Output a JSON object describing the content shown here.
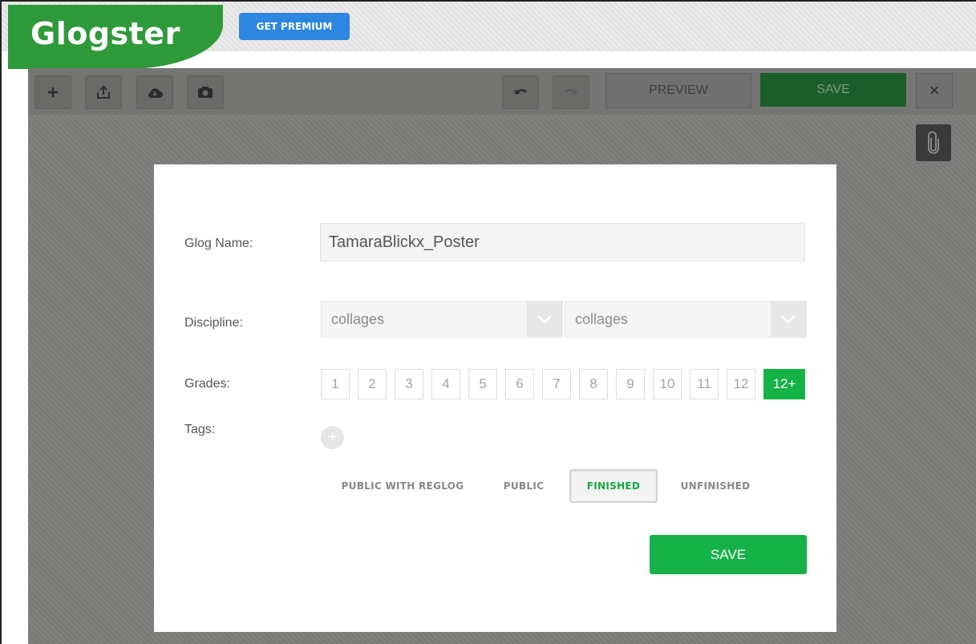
{
  "app": {
    "logo_text": "Glogster",
    "premium_label": "GET PREMIUM"
  },
  "toolbar": {
    "icons": [
      "plus-icon",
      "upload-icon",
      "cloud-icon",
      "camera-icon",
      "undo-icon",
      "redo-icon",
      "close-icon",
      "paperclip-icon"
    ],
    "preview_label": "PREVIEW",
    "save_label": "SAVE",
    "close_label": "×"
  },
  "dialog": {
    "name_label": "Glog Name:",
    "name_value": "TamaraBlickx_Poster",
    "discipline_label": "Discipline:",
    "discipline_primary": "collages",
    "discipline_secondary": "collages",
    "grades_label": "Grades:",
    "grades": [
      "1",
      "2",
      "3",
      "4",
      "5",
      "6",
      "7",
      "8",
      "9",
      "10",
      "11",
      "12",
      "12+"
    ],
    "selected_grade": "12+",
    "tags_label": "Tags:",
    "tag_add_label": "+",
    "status_options": [
      "PUBLIC WITH REGLOG",
      "PUBLIC",
      "FINISHED",
      "UNFINISHED"
    ],
    "selected_status": "FINISHED",
    "save_label": "SAVE"
  },
  "colors": {
    "brand_green": "#2e9a3a",
    "accent_green": "#15b248",
    "premium_blue": "#2d87e0",
    "overlay_gray": "#7e7e7d"
  }
}
